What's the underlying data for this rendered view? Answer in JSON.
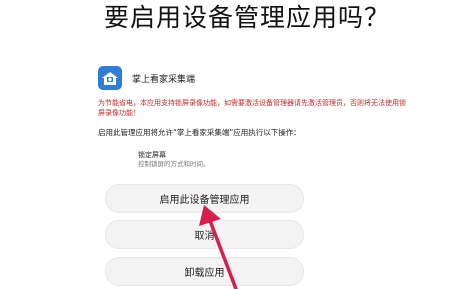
{
  "dialog": {
    "title": "要启用设备管理应用吗？",
    "app_name": "掌上看家采集端",
    "description": "为节能省电，本应用支持锁屏录像功能，如需要激活设备管理器请先激活管理员，否则将无法使用锁屏录像功能！",
    "permission_intro": "启用此管理应用将允许“掌上看家采集端”应用执行以下操作：",
    "permission_title": "锁定屏幕",
    "permission_desc": "控制锁屏的方式和时间。",
    "activate_label": "启用此设备管理应用",
    "cancel_label": "取消",
    "uninstall_label": "卸载应用"
  },
  "colors": {
    "warning_text": "#c62828",
    "annotation_arrow": "#d6204b",
    "app_icon": "#2f7dd6"
  }
}
